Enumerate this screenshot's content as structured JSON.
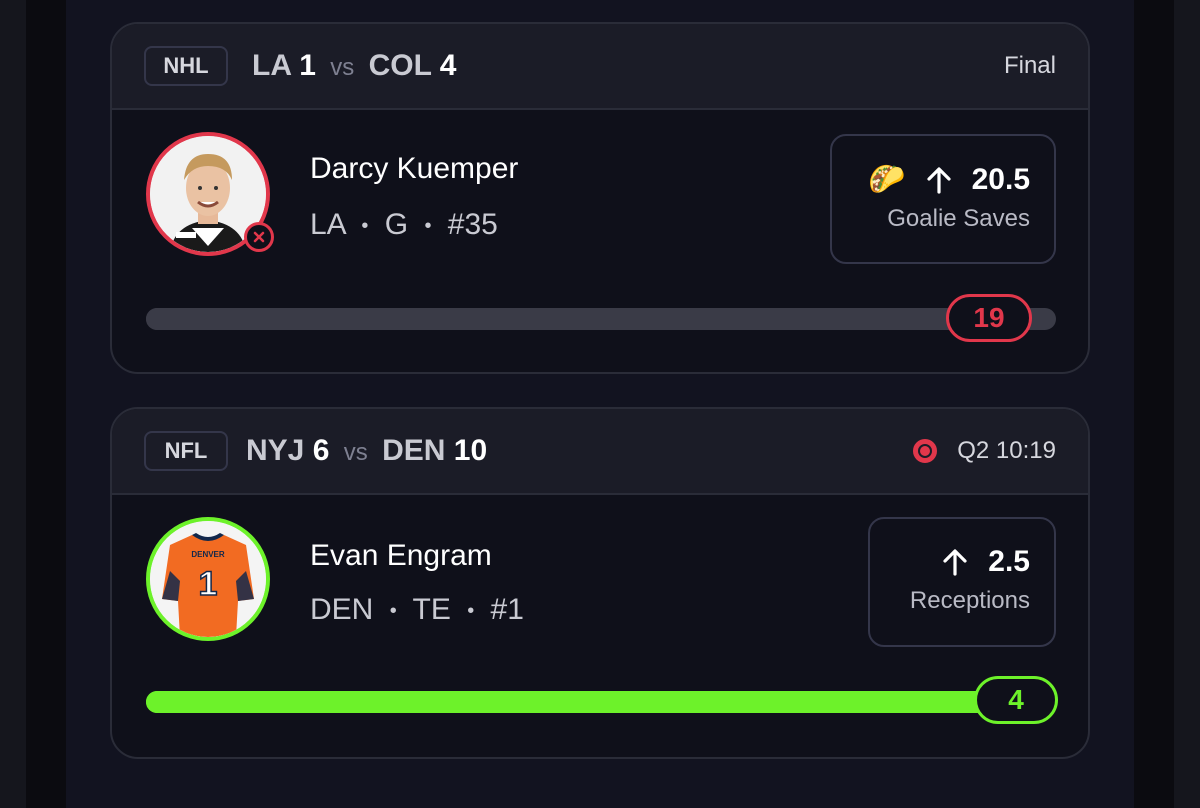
{
  "cards": [
    {
      "league": "NHL",
      "away_team": "LA",
      "away_score": "1",
      "vs": "vs",
      "home_team": "COL",
      "home_score": "4",
      "status": "Final",
      "player_name": "Darcy Kuemper",
      "player_team": "LA",
      "player_position": "G",
      "player_number": "#35",
      "meta_separator": "•",
      "stat_emoji": "🌮",
      "stat_direction_icon": "arrow-up-icon",
      "stat_line": "20.5",
      "stat_label": "Goalie Saves",
      "progress_value": "19",
      "progress_fraction": 0.93,
      "accent_color": "#e1374b"
    },
    {
      "league": "NFL",
      "away_team": "NYJ",
      "away_score": "6",
      "vs": "vs",
      "home_team": "DEN",
      "home_score": "10",
      "status_icon": "live-record-icon",
      "status": "Q2 10:19",
      "player_name": "Evan Engram",
      "player_team": "DEN",
      "player_position": "TE",
      "player_number": "#1",
      "meta_separator": "•",
      "stat_direction_icon": "arrow-up-icon",
      "stat_line": "2.5",
      "stat_label": "Receptions",
      "progress_value": "4",
      "progress_fraction": 1.0,
      "jersey_text": "DENVER",
      "jersey_number": "1",
      "accent_color": "#6df22a"
    }
  ]
}
